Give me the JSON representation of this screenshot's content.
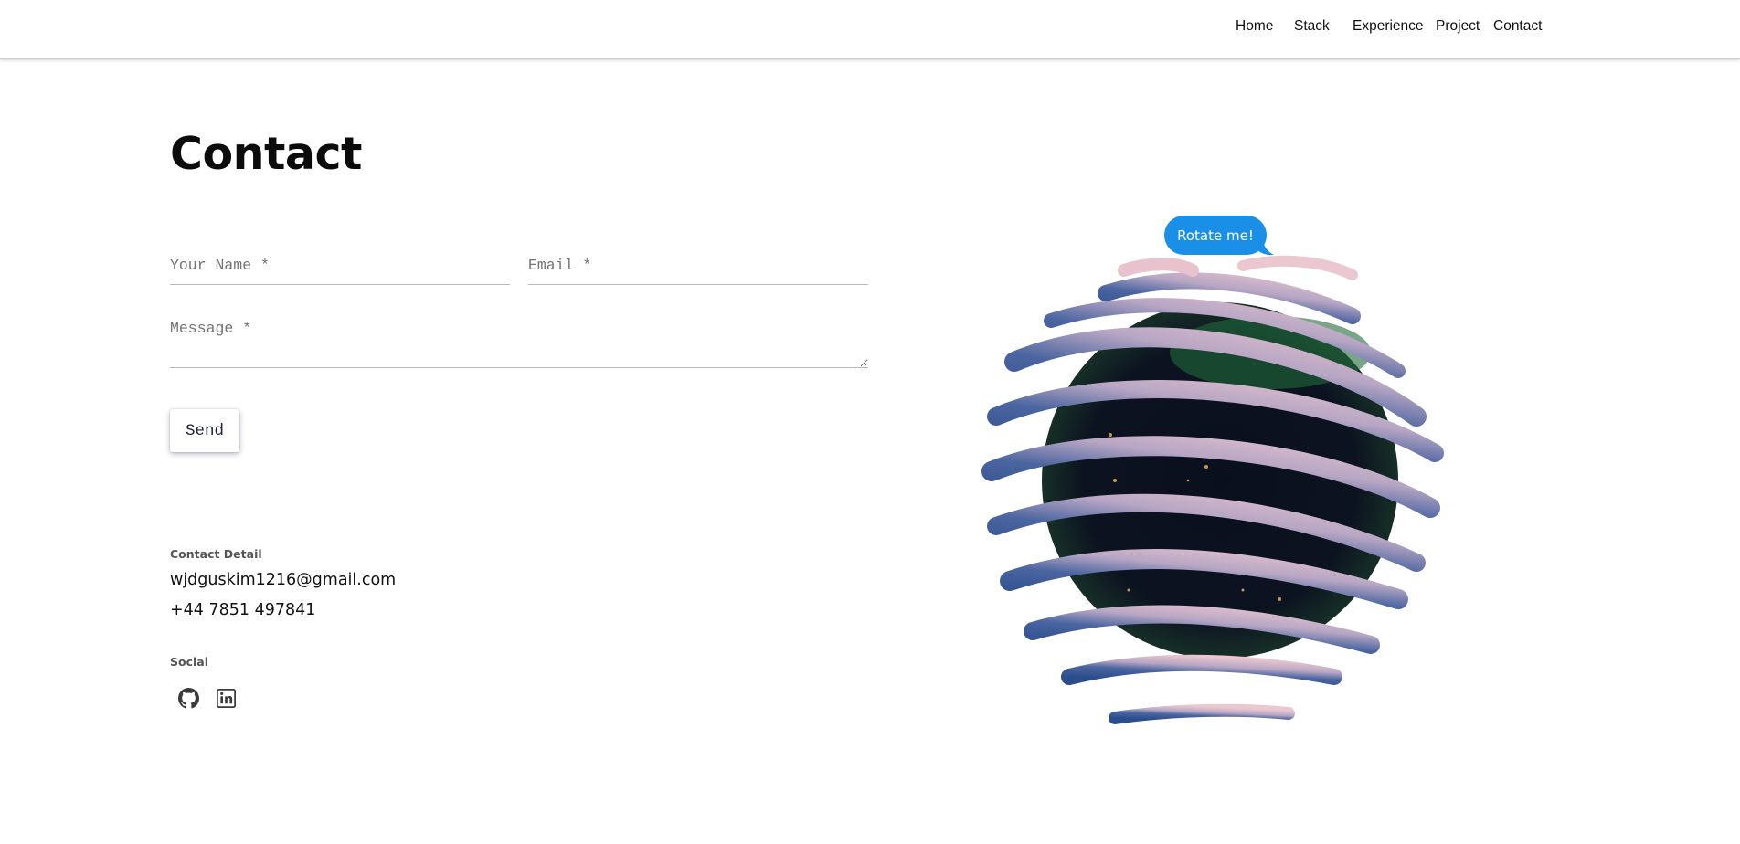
{
  "nav": {
    "items": [
      {
        "label": "Home"
      },
      {
        "label": "Stack"
      },
      {
        "label": "Experience"
      },
      {
        "label": "Project"
      },
      {
        "label": "Contact"
      }
    ]
  },
  "contact": {
    "title": "Contact",
    "form": {
      "name_placeholder": "Your Name *",
      "email_placeholder": "Email *",
      "message_placeholder": "Message *",
      "send_label": "Send"
    },
    "detail_label": "Contact Detail",
    "email": "wjdguskim1216@gmail.com",
    "phone": "+44 7851 497841",
    "social_label": "Social",
    "social_icons": [
      "github-icon",
      "linkedin-icon"
    ]
  },
  "globe": {
    "bubble_text": "Rotate me!"
  },
  "colors": {
    "bubble": "#1a8fe8",
    "ribbon_pink": "#e3bccb",
    "ribbon_blue": "#2d4f8a",
    "globe_core": "#0a0f1c"
  }
}
